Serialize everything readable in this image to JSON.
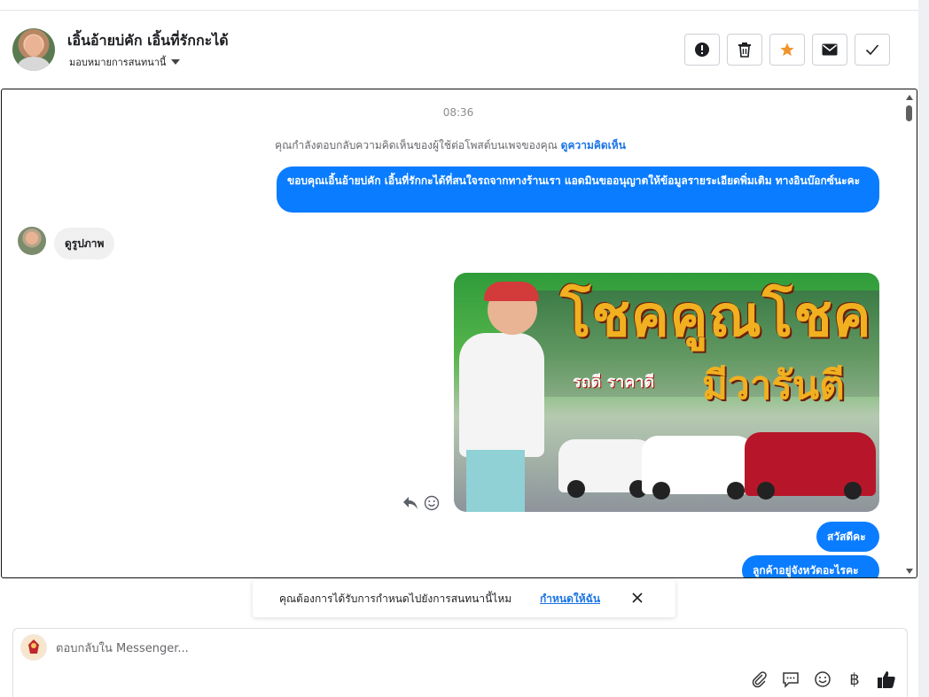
{
  "header": {
    "contact_name": "เอิ้นอ้ายบ่คัก เอิ้นที่รักกะได้",
    "assign_label": "มอบหมายการสนทนานี้",
    "actions": [
      {
        "name": "spam-button",
        "icon": "exclamation-icon"
      },
      {
        "name": "delete-button",
        "icon": "trash-icon"
      },
      {
        "name": "follow-up-button",
        "icon": "star-icon",
        "color": "#f0932b"
      },
      {
        "name": "mark-unread-button",
        "icon": "envelope-icon"
      },
      {
        "name": "done-button",
        "icon": "check-icon"
      }
    ]
  },
  "conversation": {
    "time": "08:36",
    "reply_note": "คุณกำลังตอบกลับความคิดเห็นของผู้ใช้ต่อโพสต์บนเพจของคุณ",
    "reply_note_link": "ดูความคิดเห็น",
    "messages": [
      {
        "from": "page",
        "text": "ขอบคุณเอิ้นอ้ายบ่คัก เอิ้นที่รักกะได้ที่สนใจรถจากทางร้านเรา แอดมินขออนุญาตให้ข้อมูลรายระเอียดพิ่มเติม ทางอินบ๊อกซ์นะคะ"
      },
      {
        "from": "user",
        "text": "ดูรูปภาพ"
      },
      {
        "from": "page",
        "type": "image",
        "title_main": "โชคคูณโชค",
        "title_sub": "รถดี ราคาดี",
        "title_warranty": "มีวารันตี"
      },
      {
        "from": "page",
        "text": "สวัสดีคะ"
      },
      {
        "from": "page",
        "text": "ลูกค้าอยู่จังหวัดอะไรคะ"
      }
    ],
    "accent_color": "#0a7cff"
  },
  "toast": {
    "text": "คุณต้องการได้รับการกำหนดไปยังการสนทนานี้ไหม",
    "link": "กำหนดให้ฉัน"
  },
  "composer": {
    "placeholder": "ตอบกลับใน Messenger...",
    "tools": [
      "paperclip-icon",
      "saved-reply-icon",
      "emoji-icon",
      "baht-icon",
      "thumbs-up-icon"
    ],
    "currency_symbol": "฿"
  }
}
